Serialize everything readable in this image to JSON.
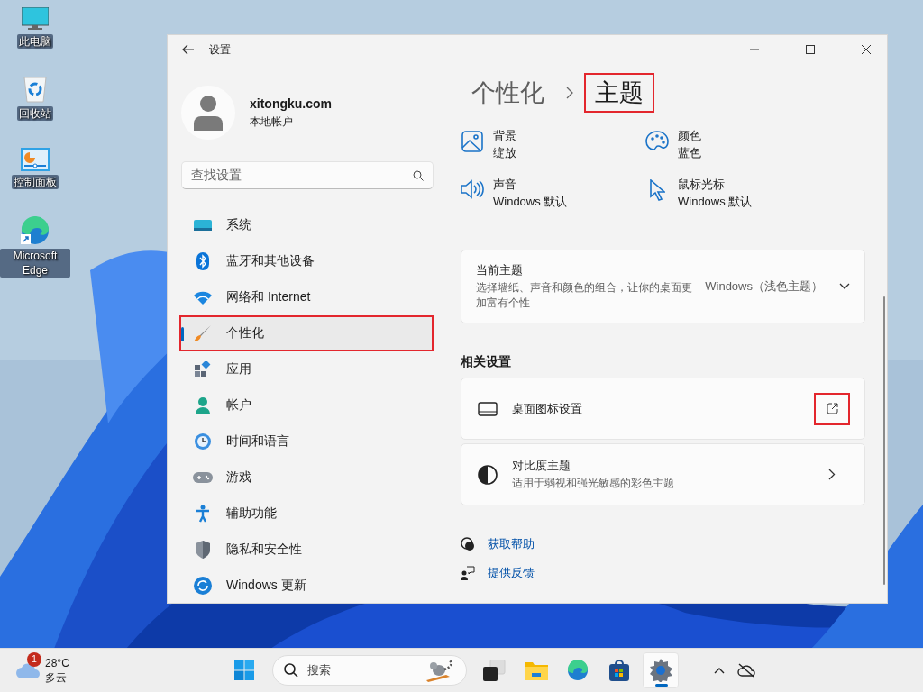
{
  "desktop_icons": [
    {
      "kind": "computer",
      "label": "此电脑"
    },
    {
      "kind": "recycle",
      "label": "回收站"
    },
    {
      "kind": "control",
      "label": "控制面板"
    },
    {
      "kind": "edge",
      "label": "Microsoft Edge"
    }
  ],
  "window": {
    "title": "设置"
  },
  "account": {
    "name": "xitongku.com",
    "type": "本地帐户"
  },
  "search": {
    "placeholder": "查找设置"
  },
  "nav": [
    {
      "kind": "system",
      "label": "系统",
      "selected": false,
      "highlighted": false
    },
    {
      "kind": "bluetooth",
      "label": "蓝牙和其他设备",
      "selected": false,
      "highlighted": false
    },
    {
      "kind": "network",
      "label": "网络和 Internet",
      "selected": false,
      "highlighted": false
    },
    {
      "kind": "personalize",
      "label": "个性化",
      "selected": true,
      "highlighted": true
    },
    {
      "kind": "apps",
      "label": "应用",
      "selected": false,
      "highlighted": false
    },
    {
      "kind": "account",
      "label": "帐户",
      "selected": false,
      "highlighted": false
    },
    {
      "kind": "time",
      "label": "时间和语言",
      "selected": false,
      "highlighted": false
    },
    {
      "kind": "gaming",
      "label": "游戏",
      "selected": false,
      "highlighted": false
    },
    {
      "kind": "accessibility",
      "label": "辅助功能",
      "selected": false,
      "highlighted": false
    },
    {
      "kind": "privacy",
      "label": "隐私和安全性",
      "selected": false,
      "highlighted": false
    },
    {
      "kind": "update",
      "label": "Windows 更新",
      "selected": false,
      "highlighted": false
    }
  ],
  "breadcrumb": [
    {
      "text": "个性化",
      "highlighted": false
    },
    {
      "text": "主题",
      "highlighted": true
    }
  ],
  "quick_settings": [
    {
      "kind": "background",
      "title": "背景",
      "value": "绽放"
    },
    {
      "kind": "color",
      "title": "颜色",
      "value": "蓝色"
    },
    {
      "kind": "sound",
      "title": "声音",
      "value": "Windows 默认"
    },
    {
      "kind": "cursor",
      "title": "鼠标光标",
      "value": "Windows 默认"
    }
  ],
  "current_theme": {
    "title": "当前主题",
    "description": "选择墙纸、声音和颜色的组合，让你的桌面更加富有个性",
    "value": "Windows（浅色主题）"
  },
  "related_heading": "相关设置",
  "related": [
    {
      "kind": "desktop",
      "title": "桌面图标设置",
      "opens_externally": true,
      "highlighted": true
    },
    {
      "kind": "contrast",
      "title": "对比度主题",
      "description": "适用于弱视和强光敏感的彩色主题",
      "opens_externally": false,
      "highlighted": false
    }
  ],
  "help_links": [
    {
      "kind": "help",
      "label": "获取帮助"
    },
    {
      "kind": "feedback",
      "label": "提供反馈"
    }
  ],
  "taskbar": {
    "weather": {
      "badge": "1",
      "temperature": "28°C",
      "condition": "多云"
    },
    "search": {
      "placeholder": "搜索"
    },
    "apps": [
      {
        "kind": "taskview",
        "selected": false
      },
      {
        "kind": "explorer",
        "selected": false
      },
      {
        "kind": "edge",
        "selected": false
      },
      {
        "kind": "store",
        "selected": false
      },
      {
        "kind": "settings",
        "selected": true
      }
    ]
  }
}
